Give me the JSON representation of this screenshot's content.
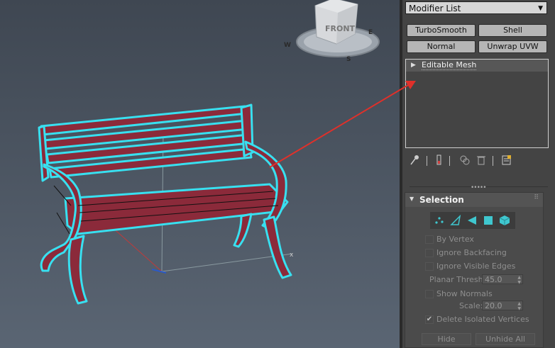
{
  "viewcube": {
    "face_label": "FRONT",
    "compass_letters": [
      "W",
      "S",
      "E"
    ]
  },
  "modifier_list": {
    "label": "Modifier List"
  },
  "modifier_buttons": [
    "TurboSmooth",
    "Shell",
    "Normal",
    "Unwrap UVW"
  ],
  "stack": {
    "items": [
      {
        "label": "Editable Mesh"
      }
    ]
  },
  "stack_toolbar": {
    "icons": [
      "pin-stack-icon",
      "show-end-result-icon",
      "make-unique-icon",
      "remove-modifier-icon",
      "configure-modifier-sets-icon"
    ]
  },
  "selection": {
    "title": "Selection",
    "levels": [
      "vertex-icon",
      "edge-icon",
      "face-icon",
      "polygon-icon",
      "element-icon"
    ],
    "by_vertex": "By Vertex",
    "ignore_backfacing": "Ignore Backfacing",
    "ignore_visible_edges": "Ignore Visible Edges",
    "planar_thresh_label": "Planar Thresh:",
    "planar_thresh_value": "45.0",
    "show_normals": "Show Normals",
    "scale_label": "Scale:",
    "scale_value": "20.0",
    "delete_isolated": "Delete Isolated Vertices",
    "delete_isolated_checked": true,
    "hide_label": "Hide",
    "unhide_all_label": "Unhide All"
  },
  "colors": {
    "bench": "#8b2a3a",
    "outline": "#38e0f0",
    "arrow": "#e0302a",
    "accent": "#3fc7cf"
  }
}
